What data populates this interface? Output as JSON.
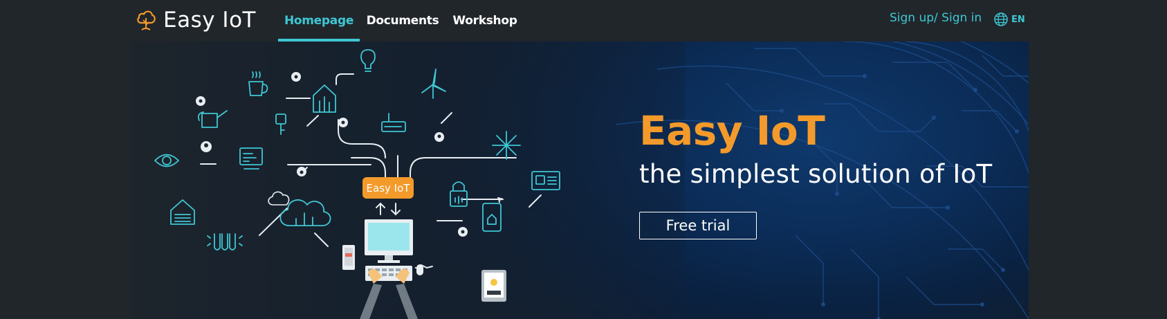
{
  "brand": {
    "name": "Easy IoT"
  },
  "nav": {
    "tabs": [
      {
        "label": "Homepage",
        "active": true
      },
      {
        "label": "Documents",
        "active": false
      },
      {
        "label": "Workshop",
        "active": false
      }
    ]
  },
  "account": {
    "signin_label": "Sign up/ Sign in"
  },
  "language": {
    "label": "EN",
    "icon": "globe-icon"
  },
  "hero": {
    "title": "Easy IoT",
    "subtitle": "the simplest solution of IoT",
    "cta_label": "Free trial",
    "badge_label": "Easy IoT"
  },
  "colors": {
    "accent": "#3ec8d4",
    "brand_orange": "#f39a2b",
    "header_bg": "#21262b",
    "hero_blue": "#0b2c57"
  }
}
